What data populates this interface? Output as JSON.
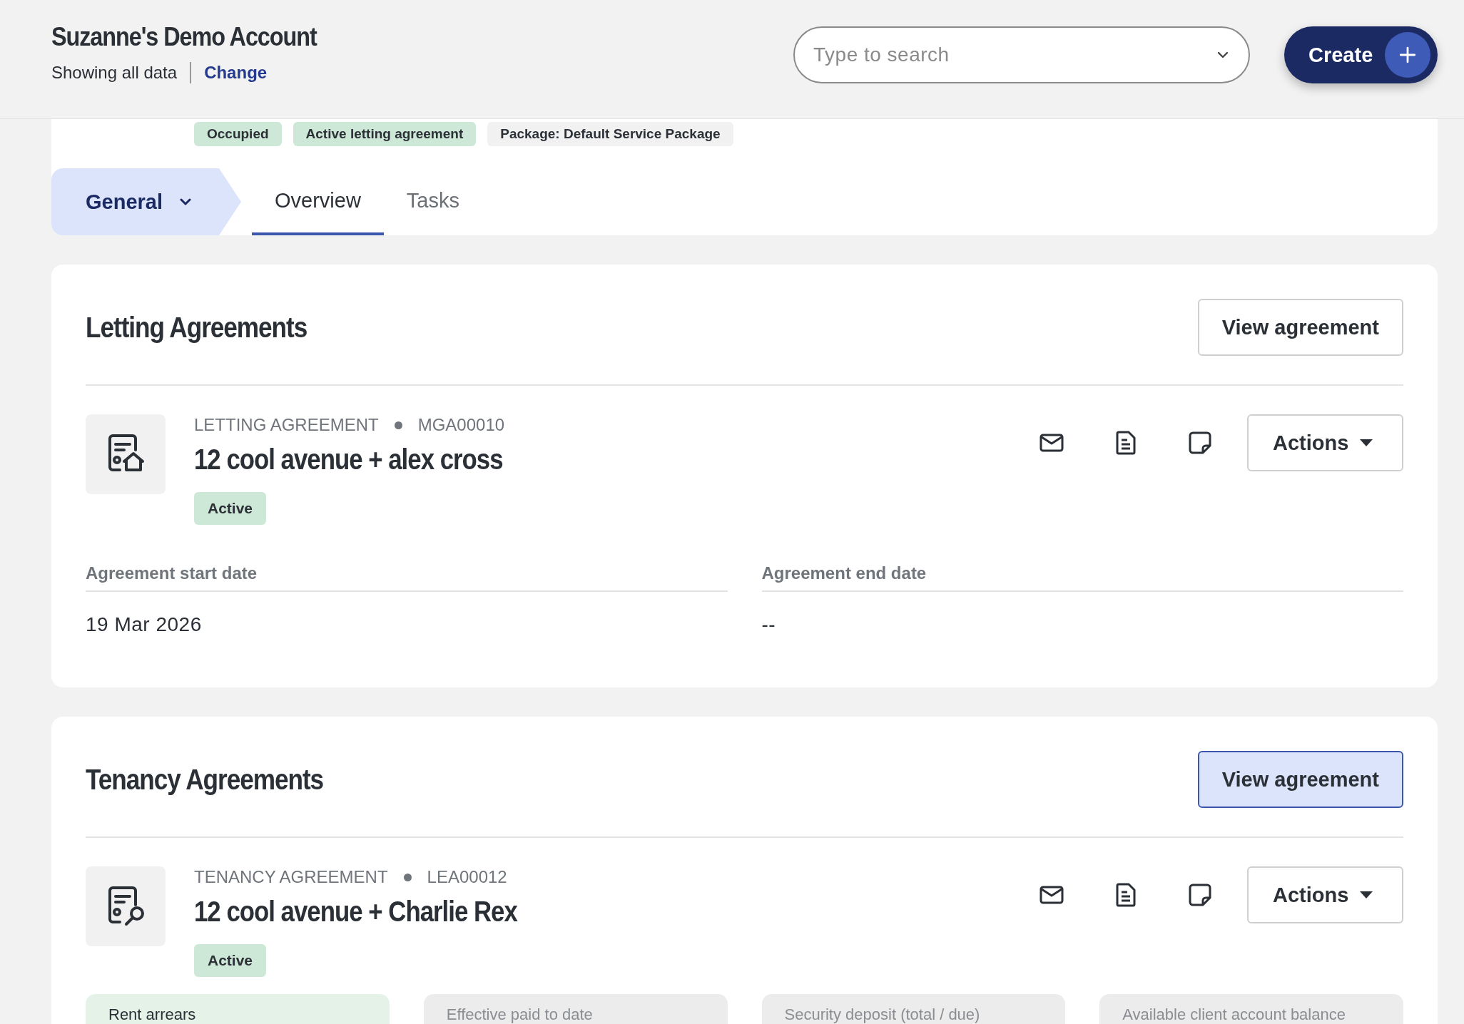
{
  "header": {
    "title": "Suzanne's Demo Account",
    "subtitle": "Showing all data",
    "change_link": "Change"
  },
  "search": {
    "placeholder": "Type to search"
  },
  "create_button": "Create",
  "tags": [
    {
      "label": "Occupied",
      "color": "#cde8d6"
    },
    {
      "label": "Active letting agreement",
      "color": "#cde8d6"
    },
    {
      "label": "Package: Default Service Package",
      "color": "#f1f1f1"
    }
  ],
  "section_menu": {
    "label": "General"
  },
  "tabs": [
    {
      "label": "Overview",
      "selected": true
    },
    {
      "label": "Tasks",
      "selected": false
    }
  ],
  "sections": [
    {
      "title": "Letting Agreements",
      "view_button": {
        "label": "View agreement",
        "focused": false
      },
      "agreement": {
        "kind": "letting",
        "type_label": "LETTING AGREEMENT",
        "ref": "MGA00010",
        "title": "12 cool avenue + alex cross",
        "status": "Active",
        "actions_label": "Actions",
        "fields": [
          {
            "label": "Agreement start date",
            "value": "19 Mar 2026"
          },
          {
            "label": "Agreement end date",
            "value": "--"
          }
        ]
      }
    },
    {
      "title": "Tenancy Agreements",
      "view_button": {
        "label": "View agreement",
        "focused": true
      },
      "agreement": {
        "kind": "tenancy",
        "type_label": "TENANCY AGREEMENT",
        "ref": "LEA00012",
        "title": "12 cool avenue + Charlie Rex",
        "status": "Active",
        "actions_label": "Actions",
        "stats": [
          {
            "label": "Rent arrears",
            "highlighted": true
          },
          {
            "label": "Effective paid to date",
            "highlighted": false
          },
          {
            "label": "Security deposit (total / due)",
            "highlighted": false
          },
          {
            "label": "Available client account balance",
            "highlighted": false
          }
        ]
      }
    }
  ]
}
